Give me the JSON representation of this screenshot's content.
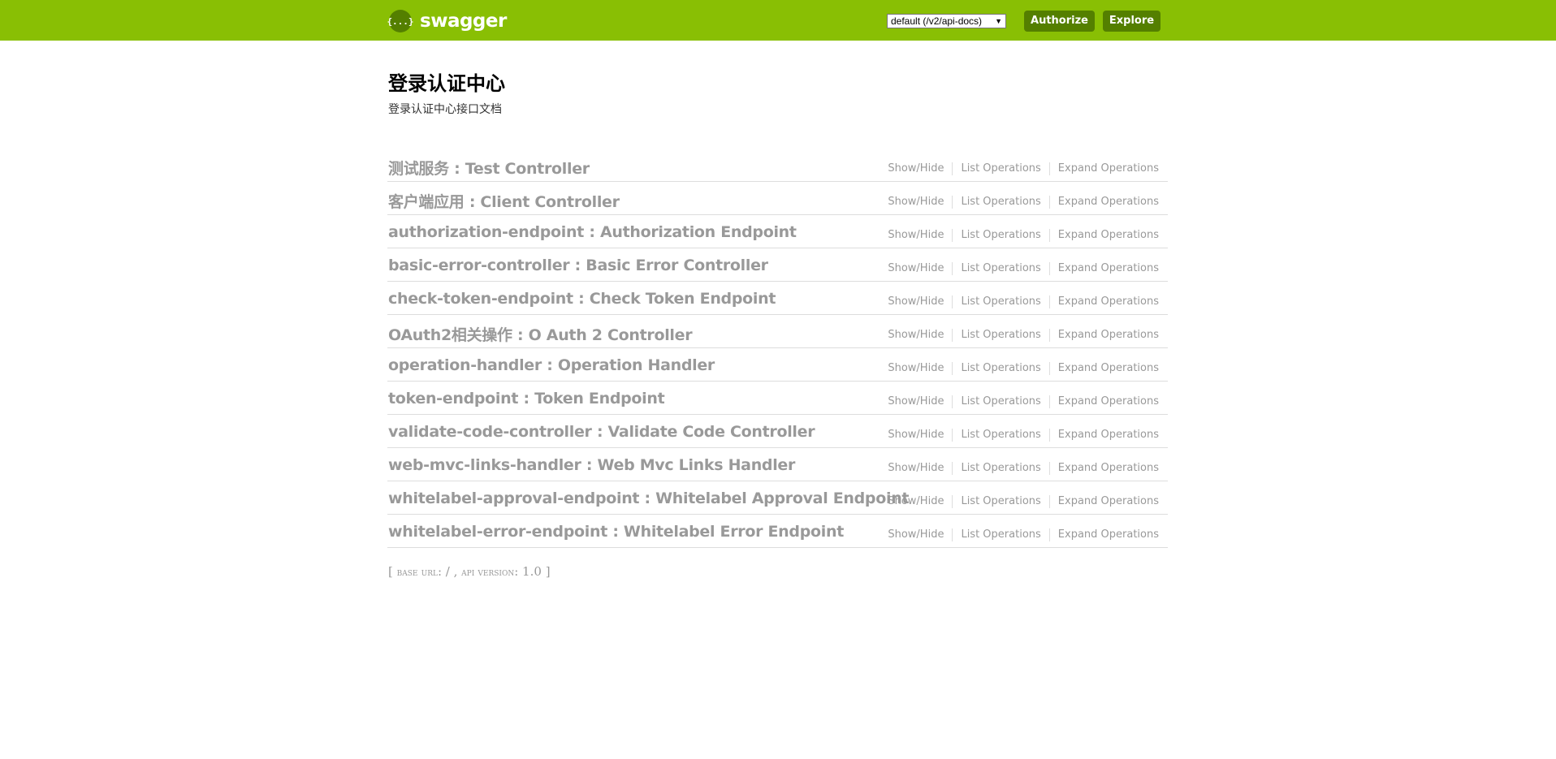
{
  "header": {
    "logo_icon": "{...}",
    "logo_text": "swagger",
    "api_select_value": "default (/v2/api-docs)",
    "authorize_label": "Authorize",
    "explore_label": "Explore",
    "background_color": "#89bf04",
    "button_color": "#547f00"
  },
  "info": {
    "title": "登录认证中心",
    "description": "登录认证中心接口文档"
  },
  "resources": [
    {
      "title": "测试服务 : Test Controller"
    },
    {
      "title": "客户端应用 : Client Controller"
    },
    {
      "title": "authorization-endpoint : Authorization Endpoint"
    },
    {
      "title": "basic-error-controller : Basic Error Controller"
    },
    {
      "title": "check-token-endpoint : Check Token Endpoint"
    },
    {
      "title": "OAuth2相关操作 : O Auth 2 Controller"
    },
    {
      "title": "operation-handler : Operation Handler"
    },
    {
      "title": "token-endpoint : Token Endpoint"
    },
    {
      "title": "validate-code-controller : Validate Code Controller"
    },
    {
      "title": "web-mvc-links-handler : Web Mvc Links Handler"
    },
    {
      "title": "whitelabel-approval-endpoint : Whitelabel Approval Endpoint"
    },
    {
      "title": "whitelabel-error-endpoint : Whitelabel Error Endpoint"
    }
  ],
  "operations": {
    "show_hide": "Show/Hide",
    "list": "List Operations",
    "expand": "Expand Operations"
  },
  "footer": {
    "open_bracket": "[",
    "base_url_label": "base url",
    "base_url_value": ": / ,",
    "api_version_label": "api version",
    "api_version_value": ": 1.0",
    "close_bracket": "]"
  }
}
